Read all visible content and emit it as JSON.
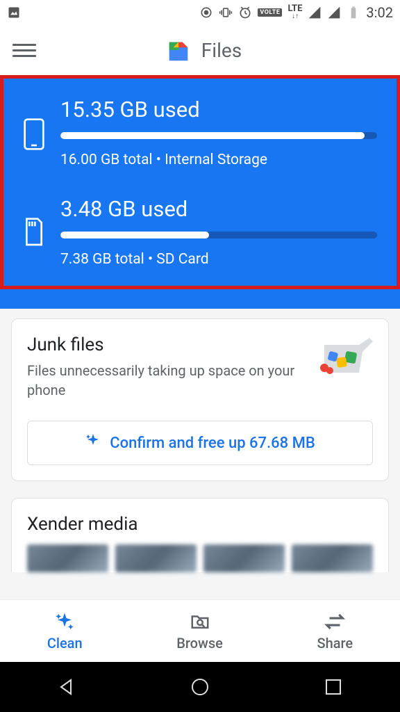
{
  "statusbar": {
    "time": "3:02",
    "volte": "VOLTE",
    "lte_top": "LTE"
  },
  "header": {
    "title": "Files"
  },
  "storage": {
    "internal": {
      "used_label": "15.35 GB used",
      "total_label": "16.00 GB total • Internal Storage",
      "used_gb": 15.35,
      "total_gb": 16.0,
      "pct": 96
    },
    "sdcard": {
      "used_label": "3.48 GB used",
      "total_label": "7.38 GB total • SD Card",
      "used_gb": 3.48,
      "total_gb": 7.38,
      "pct": 47
    }
  },
  "cards": {
    "junk": {
      "title": "Junk files",
      "desc": "Files unnecessarily taking up space on your phone",
      "confirm_label": "Confirm and free up 67.68 MB",
      "free_mb": 67.68
    },
    "xender": {
      "title": "Xender media"
    }
  },
  "bottomnav": {
    "clean": "Clean",
    "browse": "Browse",
    "share": "Share",
    "active": "clean"
  }
}
